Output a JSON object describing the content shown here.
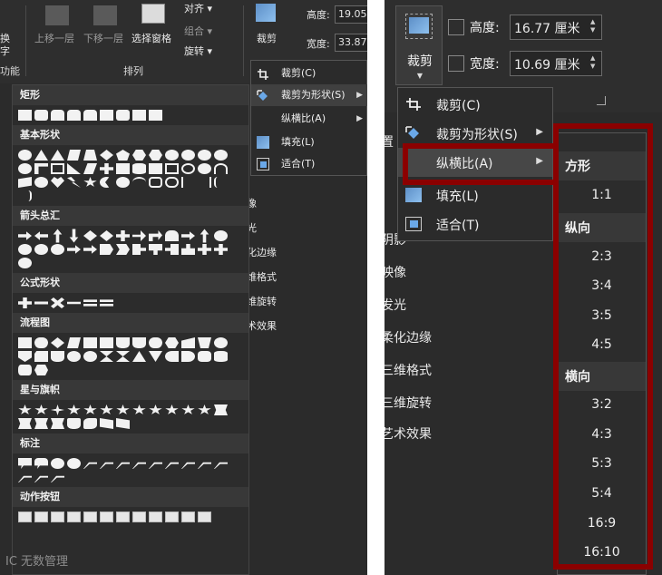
{
  "left": {
    "ribbon": {
      "swap_top": "换",
      "swap_bottom": "字",
      "group_function": "功能",
      "bring_forward": "上移一层",
      "send_backward": "下移一层",
      "selection_pane": "选择窗格",
      "align": "对齐 ▾",
      "group": "组合 ▾",
      "rotate": "旋转 ▾",
      "group_arrange": "排列",
      "crop": "裁剪",
      "height_label": "高度:",
      "height_value": "19.05",
      "width_label": "宽度:",
      "width_value": "33.87"
    },
    "crop_menu": [
      {
        "label": "裁剪(C)",
        "icon": "crop-icon"
      },
      {
        "label": "裁剪为形状(S)",
        "icon": "crop-to-shape-icon",
        "submenu": true,
        "highlighted": true
      },
      {
        "label": "纵横比(A)",
        "icon": "",
        "submenu": true
      },
      {
        "label": "填充(L)",
        "icon": "fill-icon"
      },
      {
        "label": "适合(T)",
        "icon": "fit-icon"
      }
    ],
    "shape_categories": [
      "矩形",
      "基本形状",
      "箭头总汇",
      "公式形状",
      "流程图",
      "星与旗帜",
      "标注",
      "动作按钮"
    ],
    "background_list": [
      "像",
      "光",
      "化边缘",
      "维格式",
      "维旋转",
      "术效果"
    ],
    "watermark": "IC 无数管理"
  },
  "right": {
    "ribbon": {
      "crop_label": "裁剪",
      "height_label": "高度:",
      "height_value": "16.77 厘米",
      "width_label": "宽度:",
      "width_value": "10.69 厘米"
    },
    "crop_menu": [
      {
        "label": "裁剪(C)",
        "icon": "crop-icon"
      },
      {
        "label": "裁剪为形状(S)",
        "icon": "crop-to-shape-icon",
        "submenu": true
      },
      {
        "label": "纵横比(A)",
        "icon": "",
        "submenu": true,
        "highlighted": true
      },
      {
        "label": "填充(L)",
        "icon": "fill-icon"
      },
      {
        "label": "适合(T)",
        "icon": "fit-icon"
      }
    ],
    "background_list": [
      "置",
      "阴影",
      "映像",
      "发光",
      "柔化边缘",
      "三维格式",
      "三维旋转",
      "艺术效果"
    ],
    "aspect_ratio": {
      "square_header": "方形",
      "square": [
        "1:1"
      ],
      "portrait_header": "纵向",
      "portrait": [
        "2:3",
        "3:4",
        "3:5",
        "4:5"
      ],
      "landscape_header": "横向",
      "landscape": [
        "3:2",
        "4:3",
        "5:3",
        "5:4",
        "16:9",
        "16:10"
      ]
    },
    "highlight_color": "#8b0000"
  }
}
